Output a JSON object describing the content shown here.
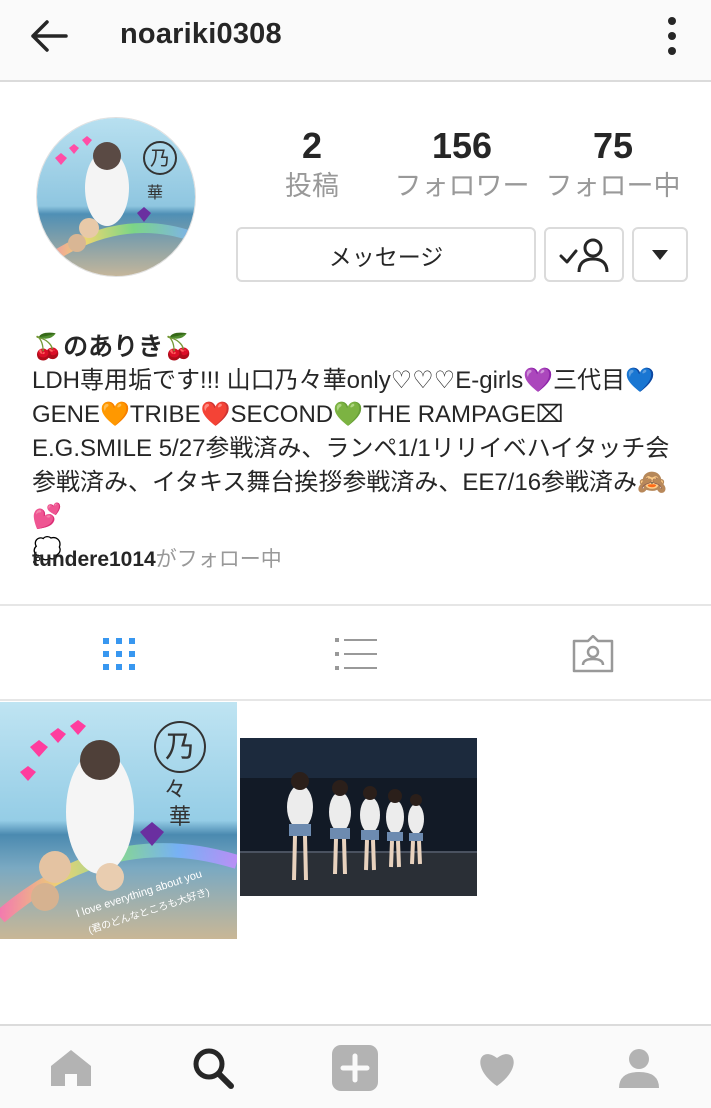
{
  "header": {
    "username": "noariki0308"
  },
  "profile": {
    "stats": [
      {
        "value": "2",
        "label": "投稿"
      },
      {
        "value": "156",
        "label": "フォロワー"
      },
      {
        "value": "75",
        "label": "フォロー中"
      }
    ],
    "message_button": "メッセージ",
    "bio_name": "🍒のありき🍒",
    "bio_text": "LDH専用垢です!!! 山口乃々華only♡♡♡E-girls💜三代目💙\nGENE🧡TRIBE❤️SECOND💚THE RAMPAGE⌧\nE.G.SMILE 5/27参戦済み、ランペ1/1リリイベハイタッチ会参戦済み、イタキス舞台挨拶参戦済み、EE7/16参戦済み🙈💕\n💭",
    "followed_by_user": "tundere1014",
    "followed_by_suffix": "がフォロー中"
  },
  "avatar_image_text": {
    "kanji_top": "乃",
    "kanji_mid": "々",
    "kanji_bottom": "華",
    "caption": "I love everything about you",
    "caption_jp": "(君のどんなところも大好き)"
  },
  "tabs": [
    {
      "icon": "grid-icon",
      "active": true
    },
    {
      "icon": "list-icon",
      "active": false
    },
    {
      "icon": "tagged-user-icon",
      "active": false
    }
  ],
  "bottom_nav": [
    {
      "icon": "home-icon"
    },
    {
      "icon": "search-icon",
      "active": true
    },
    {
      "icon": "add-post-icon"
    },
    {
      "icon": "heart-icon"
    },
    {
      "icon": "profile-icon"
    }
  ],
  "colors": {
    "active_tab": "#3897f0",
    "inactive_icon": "#999999",
    "text": "#262626",
    "muted_text": "#999999",
    "border": "#dbdbdb"
  }
}
